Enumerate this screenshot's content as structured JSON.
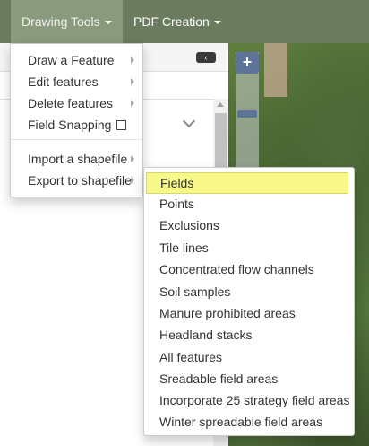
{
  "navbar": {
    "drawing_tools_label": "Drawing Tools",
    "pdf_creation_label": "PDF Creation"
  },
  "panel": {
    "collapse_icon": "‹"
  },
  "map": {
    "zoom_in_label": "+"
  },
  "drawing_menu": {
    "items": [
      {
        "label": "Draw a Feature",
        "has_submenu": true
      },
      {
        "label": "Edit features",
        "has_submenu": true
      },
      {
        "label": "Delete features",
        "has_submenu": true
      },
      {
        "label": "Field Snapping",
        "checkbox": true,
        "checked": false
      },
      {
        "label": "Import a shapefile",
        "has_submenu": true
      },
      {
        "label": "Export to shapefile",
        "has_submenu": true
      }
    ]
  },
  "export_submenu": {
    "highlighted": "Fields",
    "items": [
      {
        "label": "Fields"
      },
      {
        "label": "Points"
      },
      {
        "label": "Exclusions"
      },
      {
        "label": "Tile lines"
      },
      {
        "label": "Concentrated flow channels"
      },
      {
        "label": "Soil samples"
      },
      {
        "label": "Manure prohibited areas"
      },
      {
        "label": "Headland stacks"
      },
      {
        "label": "All features"
      },
      {
        "label": "Sreadable field areas"
      },
      {
        "label": "Incorporate 25 strategy field areas"
      },
      {
        "label": "Winter spreadable field areas"
      }
    ]
  },
  "colors": {
    "navbar": "#6b7b5e",
    "navbar_active": "#8a9a7c",
    "highlight": "#f7f78a",
    "map_control": "#5d7399"
  }
}
